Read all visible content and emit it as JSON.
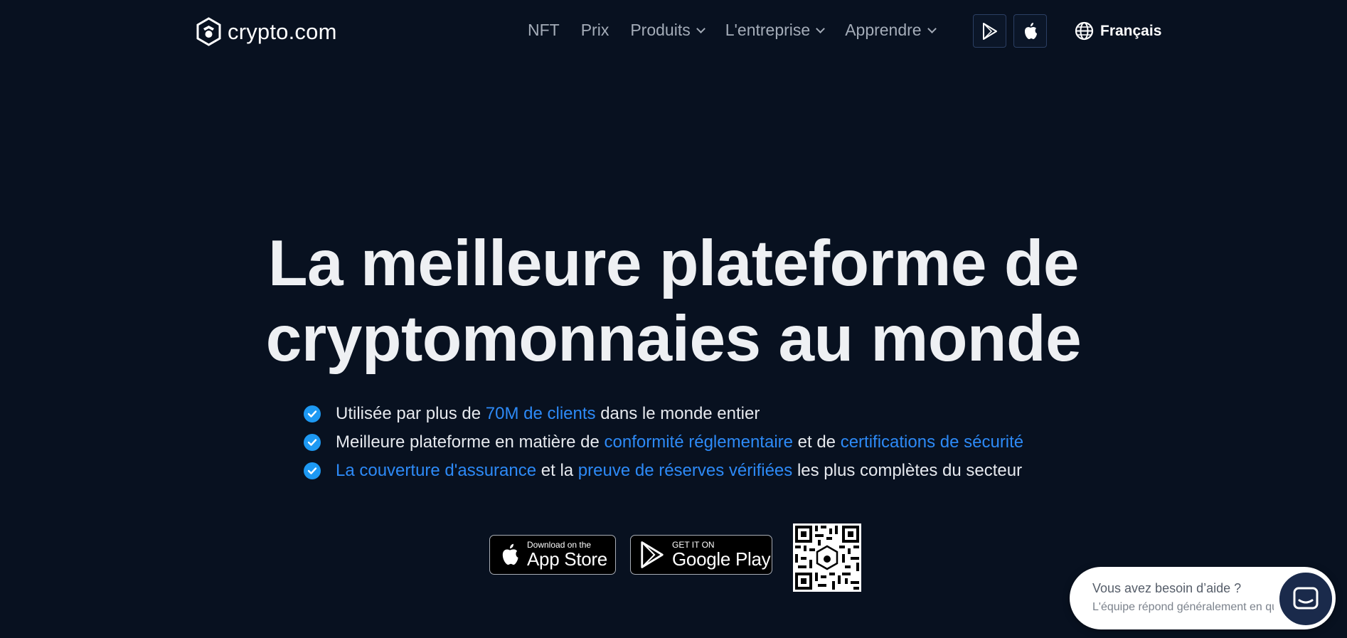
{
  "header": {
    "logo_text": "crypto.com",
    "nav": [
      {
        "label": "NFT"
      },
      {
        "label": "Prix"
      },
      {
        "label": "Produits"
      },
      {
        "label": "L'entreprise"
      },
      {
        "label": "Apprendre"
      }
    ],
    "language": "Français"
  },
  "hero": {
    "title_line1": "La meilleure plateforme de",
    "title_line2": "cryptomonnaies au monde",
    "bullets": [
      {
        "t1": "Utilisée par plus de ",
        "l1": "70M de clients",
        "t2": " dans le monde entier"
      },
      {
        "t1": "Meilleure plateforme en matière de ",
        "l1": "conformité réglementaire",
        "t2": " et de ",
        "l2": "certifications de sécurité"
      },
      {
        "l1": "La couverture d'assurance",
        "t1": " et la ",
        "l2": "preuve de réserves vérifiées",
        "t2": " les plus complètes du secteur"
      }
    ]
  },
  "badges": {
    "appstore_small": "Download on the",
    "appstore_big": "App Store",
    "googleplay_small": "GET IT ON",
    "googleplay_big": "Google Play"
  },
  "help": {
    "title": "Vous avez besoin d’aide ?",
    "subtitle": "L'équipe répond généralement en quelques minutes"
  },
  "colors": {
    "background": "#081120",
    "accent_link": "#2d8af7",
    "check": "#1d99f3"
  }
}
